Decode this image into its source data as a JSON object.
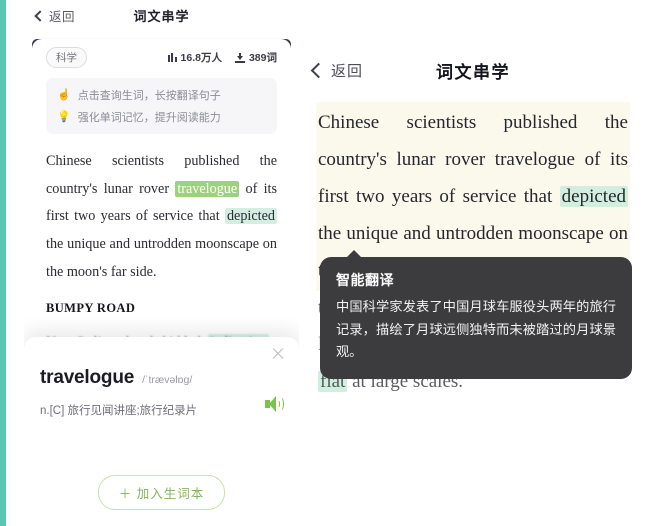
{
  "left": {
    "nav": {
      "back_label": "返回",
      "title": "词文串学",
      "back_icon": "chevron-left-icon"
    },
    "card": {
      "tag": "科学",
      "stats": [
        {
          "icon": "bar-chart-icon",
          "value": "16.8万人"
        },
        {
          "icon": "download-icon",
          "value": "389词"
        }
      ],
      "tips": [
        {
          "icon": "pointing-hand-icon",
          "text": "点击查询生词，长按翻译句子"
        },
        {
          "icon": "lightbulb-icon",
          "text": "强化单词记忆，提升阅读能力"
        }
      ]
    },
    "article": {
      "paragraph_parts": [
        {
          "text": "Chinese scientists published the country's lunar rover ",
          "style": "plain"
        },
        {
          "text": "travelogue",
          "style": "highlight-solid"
        },
        {
          "text": " of its first two years of service that ",
          "style": "plain"
        },
        {
          "text": "depicted",
          "style": "highlight-soft"
        },
        {
          "text": " the unique and untrodden moonscape on the moon's far side.",
          "style": "plain"
        }
      ],
      "section_heading": "BUMPY ROAD",
      "faded_parts": [
        {
          "text": "Yutu-2 slipped and skidded, ",
          "style": "plain"
        },
        {
          "text": "indicating",
          "style": "highlight-soft"
        }
      ]
    },
    "dictionary": {
      "word": "travelogue",
      "phonetic": "/ˈtrævəlɒɡ/",
      "definition": "n.[C] 旅行见闻讲座;旅行纪录片",
      "close_icon": "close-icon",
      "speaker_icon": "speaker-icon",
      "add_button": "＋ 加入生词本"
    }
  },
  "right": {
    "nav": {
      "back_label": "返回",
      "title": "词文串学",
      "back_icon": "chevron-left-icon"
    },
    "selected_parts": [
      {
        "text": "Chinese scientists published the country's lunar rover travelogue of its first two years of service that ",
        "style": "plain"
      },
      {
        "text": "depicted",
        "style": "highlight-soft"
      },
      {
        "text": " the unique and untrodden moonscape on the moon's far side.",
        "style": "plain"
      }
    ],
    "following_parts": [
      {
        "text": "the terrain it landed on is ",
        "style": "plain"
      },
      {
        "text": "scattered",
        "style": "highlight-soft"
      },
      {
        "text": " with local gentle slopes, although relatively ",
        "style": "plain"
      },
      {
        "text": "flat",
        "style": "highlight-soft"
      },
      {
        "text": " at large scales.",
        "style": "plain"
      }
    ],
    "tooltip": {
      "title": "智能翻译",
      "body": "中国科学家发表了中国月球车服役头两年的旅行记录，描绘了月球远侧独特而未被踏过的月球景观。"
    }
  },
  "colors": {
    "accent_green": "#9ed17e",
    "soft_green": "#d4efe2",
    "dark_navy": "#353b4c",
    "tooltip_bg": "#3c3c3e",
    "selection_cream": "#fbf8ec",
    "edge_teal": "#5ac6b0"
  }
}
